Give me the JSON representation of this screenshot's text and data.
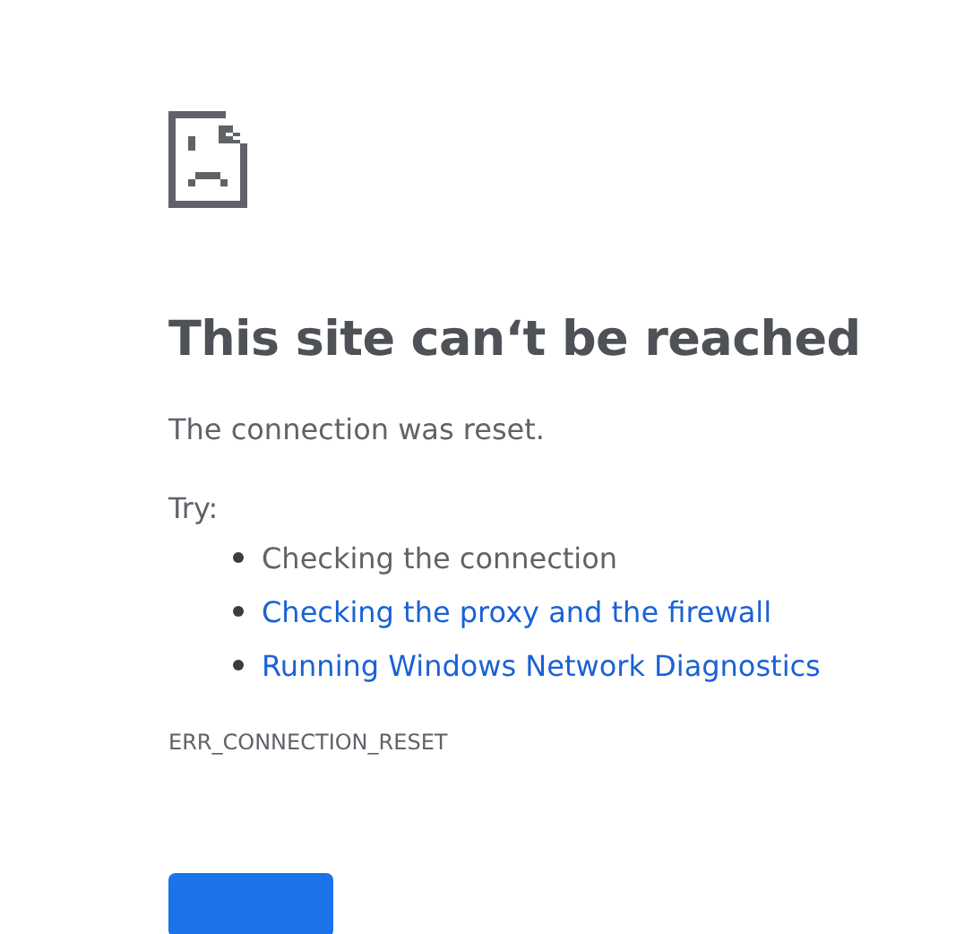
{
  "title": "This site can‘t be reached",
  "message": "The connection was reset.",
  "try_label": "Try:",
  "suggestions": [
    {
      "text": "Checking the connection",
      "kind": "text"
    },
    {
      "text": "Checking the proxy and the firewall",
      "kind": "link"
    },
    {
      "text": "Running Windows Network Diagnostics",
      "kind": "link"
    }
  ],
  "error_code": "ERR_CONNECTION_RESET"
}
